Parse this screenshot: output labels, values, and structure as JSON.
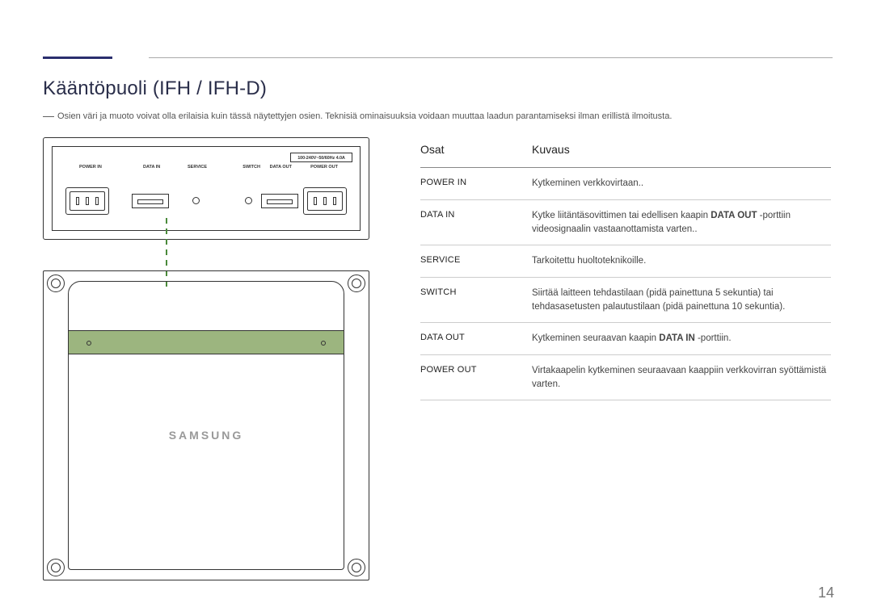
{
  "page": {
    "number": "14",
    "section_title": "Kääntöpuoli (IFH / IFH-D)",
    "note_dash": "―",
    "note": "Osien väri ja muoto voivat olla erilaisia kuin tässä näytettyjen osien. Teknisiä ominaisuuksia voidaan muuttaa laadun parantamiseksi ilman erillistä ilmoitusta."
  },
  "diagram": {
    "spec": "100-240V~50/60Hz 4.0A",
    "port_labels": {
      "power_in": "POWER IN",
      "data_in": "DATA IN",
      "service": "SERVICE",
      "switch": "SWITCH",
      "data_out": "DATA OUT",
      "power_out": "POWER OUT"
    },
    "brand": "SAMSUNG"
  },
  "table": {
    "headers": {
      "parts": "Osat",
      "desc": "Kuvaus"
    },
    "rows": [
      {
        "part": "POWER IN",
        "desc_pre": "Kytkeminen verkkovirtaan..",
        "bold": "",
        "desc_post": ""
      },
      {
        "part": "DATA IN",
        "desc_pre": "Kytke liitäntäsovittimen tai edellisen kaapin ",
        "bold": "DATA OUT",
        "desc_post": " -porttiin videosignaalin vastaanottamista varten.."
      },
      {
        "part": "SERVICE",
        "desc_pre": "Tarkoitettu huoltoteknikoille.",
        "bold": "",
        "desc_post": ""
      },
      {
        "part": "SWITCH",
        "desc_pre": "Siirtää laitteen tehdastilaan (pidä painettuna 5 sekuntia) tai tehdasasetusten palautustilaan (pidä painettuna 10 sekuntia).",
        "bold": "",
        "desc_post": ""
      },
      {
        "part": "DATA OUT",
        "desc_pre": "Kytkeminen seuraavan kaapin ",
        "bold": "DATA IN",
        "desc_post": " -porttiin."
      },
      {
        "part": "POWER OUT",
        "desc_pre": "Virtakaapelin kytkeminen seuraavaan kaappiin verkkovirran syöttämistä varten.",
        "bold": "",
        "desc_post": ""
      }
    ]
  }
}
